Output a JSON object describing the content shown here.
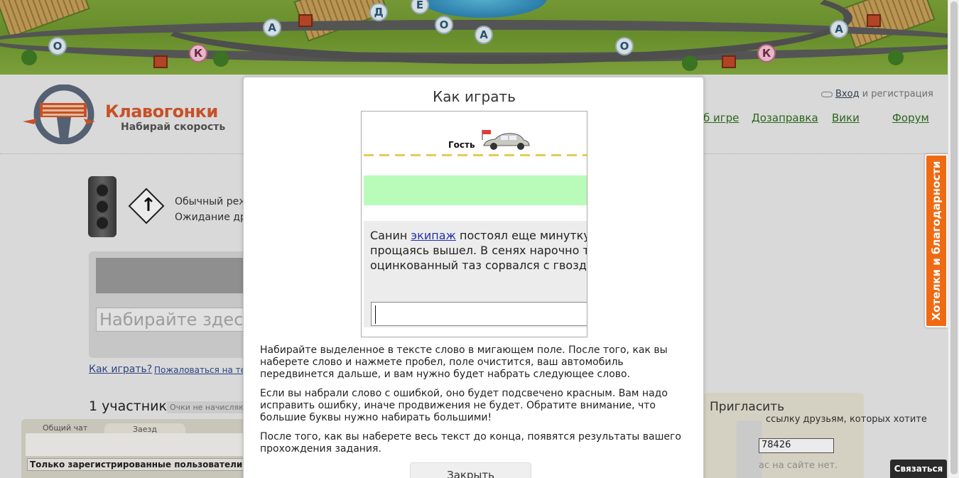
{
  "banner": {
    "letters": [
      "О",
      "К",
      "А",
      "Д",
      "Е",
      "О",
      "А",
      "К",
      "О",
      "А"
    ]
  },
  "header": {
    "logo_title": "Клавогонки",
    "logo_subtitle": "Набирай скорость",
    "login_link": "Вход",
    "login_rest": " и регистрация",
    "nav": [
      "б игре",
      "Дозаправка",
      "Вики",
      "Форум"
    ]
  },
  "race": {
    "mode_line1": "Обычный режи",
    "mode_line2": "Ожидание дру",
    "input_placeholder": "Набирайте здесь",
    "howto_link": "Как играть?",
    "complain_link": "Пожаловаться на тек",
    "participants": "1 участник",
    "points_note": "Очки не начисляются"
  },
  "chat": {
    "tabs": [
      "Общий чат",
      "Заезд"
    ],
    "message": "Только зарегистрированные пользователи могут"
  },
  "invite": {
    "title": "Пригласить",
    "text": "ссылку друзьям, которых хотите",
    "code": "78426",
    "note": "ас на сайте нет."
  },
  "modal": {
    "title": "Как играть",
    "demo_guest": "Гость",
    "demo_text_before": "Санин ",
    "demo_text_link": "экипаж",
    "demo_text_after": " постоял еще минутку и,",
    "demo_line2": "прощаясь вышел. В сенях нарочно топ",
    "demo_line3": "оцинкованный таз сорвался с гвоздя и",
    "para1": "Набирайте выделенное в тексте слово в мигающем поле. После того, как вы наберете слово и нажмете пробел, поле очистится, ваш автомобиль передвинется дальше, и вам нужно будет набрать следующее слово.",
    "para2": "Если вы набрали слово с ошибкой, оно будет подсвечено красным. Вам надо исправить ошибку, иначе продвижения не будет. Обратите внимание, что большие буквы нужно набирать большими!",
    "para3": "После того, как вы наберете весь текст до конца, появятся результаты вашего прохождения задания.",
    "close_label": "Закрыть"
  },
  "side": {
    "wishes_tab": "Хотелки и благодарности",
    "contact_label": "Связаться"
  },
  "colors": {
    "accent_orange": "#f06a14",
    "nav_green": "#2f6e1f",
    "demo_highlight": "#b9fcb9"
  }
}
